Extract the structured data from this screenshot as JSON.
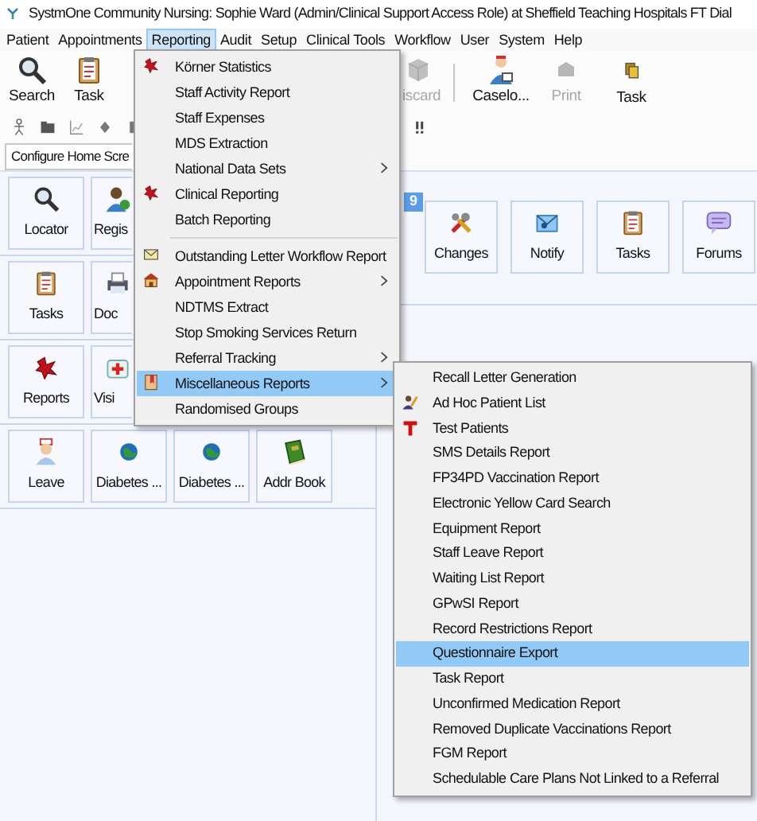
{
  "window": {
    "title": "SystmOne Community Nursing: Sophie Ward (Admin/Clinical Support Access Role) at Sheffield Teaching Hospitals FT Dial"
  },
  "menu_bar": [
    {
      "label": "Patient",
      "selected": false
    },
    {
      "label": "Appointments",
      "selected": false
    },
    {
      "label": "Reporting",
      "selected": true
    },
    {
      "label": "Audit",
      "selected": false
    },
    {
      "label": "Setup",
      "selected": false
    },
    {
      "label": "Clinical Tools",
      "selected": false
    },
    {
      "label": "Workflow",
      "selected": false
    },
    {
      "label": "User",
      "selected": false
    },
    {
      "label": "System",
      "selected": false
    },
    {
      "label": "Help",
      "selected": false
    }
  ],
  "toolbar": [
    {
      "label": "Search",
      "disabled": false
    },
    {
      "label": "Task",
      "disabled": false
    },
    {
      "label": "iscard",
      "disabled": true
    },
    {
      "label": "Caselo...",
      "disabled": false
    },
    {
      "label": "Print",
      "disabled": true
    },
    {
      "label": "Task",
      "disabled": false
    }
  ],
  "configure_button": "Configure Home Scre",
  "left_tiles": [
    [
      "Locator",
      "Regis"
    ],
    [
      "Tasks",
      "Doc"
    ],
    [
      "Reports",
      "Visi"
    ],
    [
      "Leave",
      "Diabetes ...",
      "Diabetes ...",
      "Addr Book"
    ]
  ],
  "tab_badge": "9",
  "right_tiles": [
    "Changes",
    "Notify",
    "Tasks",
    "Forums"
  ],
  "reporting_menu": [
    [
      {
        "label": "Körner Statistics",
        "submenu": false,
        "selected": false
      },
      {
        "label": "Staff Activity Report",
        "submenu": false,
        "selected": false
      },
      {
        "label": "Staff Expenses",
        "submenu": false,
        "selected": false
      },
      {
        "label": "MDS Extraction",
        "submenu": false,
        "selected": false
      },
      {
        "label": "National Data Sets",
        "submenu": true,
        "selected": false
      },
      {
        "label": "Clinical Reporting",
        "submenu": false,
        "selected": false
      },
      {
        "label": "Batch Reporting",
        "submenu": false,
        "selected": false
      }
    ],
    [
      {
        "label": "Outstanding Letter Workflow Report",
        "submenu": false,
        "selected": false
      },
      {
        "label": "Appointment Reports",
        "submenu": true,
        "selected": false
      },
      {
        "label": "NDTMS Extract",
        "submenu": false,
        "selected": false
      },
      {
        "label": "Stop Smoking Services Return",
        "submenu": false,
        "selected": false
      },
      {
        "label": "Referral Tracking",
        "submenu": true,
        "selected": false
      },
      {
        "label": "Miscellaneous Reports",
        "submenu": true,
        "selected": true
      },
      {
        "label": "Randomised Groups",
        "submenu": false,
        "selected": false
      }
    ]
  ],
  "miscellaneous_submenu": [
    {
      "label": "Recall Letter Generation",
      "selected": false
    },
    {
      "label": "Ad Hoc Patient List",
      "selected": false
    },
    {
      "label": "Test Patients",
      "selected": false
    },
    {
      "label": "SMS Details Report",
      "selected": false
    },
    {
      "label": "FP34PD Vaccination Report",
      "selected": false
    },
    {
      "label": "Electronic Yellow Card Search",
      "selected": false
    },
    {
      "label": "Equipment Report",
      "selected": false
    },
    {
      "label": "Staff Leave Report",
      "selected": false
    },
    {
      "label": "Waiting List Report",
      "selected": false
    },
    {
      "label": "GPwSI Report",
      "selected": false
    },
    {
      "label": "Record Restrictions Report",
      "selected": false
    },
    {
      "label": "Questionnaire Export",
      "selected": true
    },
    {
      "label": "Task Report",
      "selected": false
    },
    {
      "label": "Unconfirmed Medication Report",
      "selected": false
    },
    {
      "label": "Removed Duplicate Vaccinations Report",
      "selected": false
    },
    {
      "label": "FGM Report",
      "selected": false
    },
    {
      "label": "Schedulable Care Plans Not Linked to a Referral",
      "selected": false
    }
  ]
}
